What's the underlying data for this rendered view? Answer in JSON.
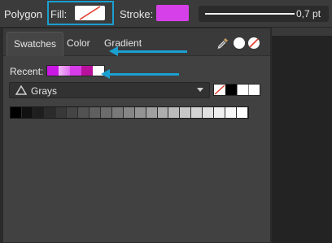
{
  "toolbar": {
    "tool_name": "Polygon",
    "fill_label": "Fill:",
    "fill_color": "none",
    "stroke_label": "Stroke:",
    "stroke_color": "#d640e8",
    "stroke_width_value": "0,7 pt",
    "accent_highlight": "#1a9fd1"
  },
  "panel": {
    "tabs": [
      {
        "label": "Swatches",
        "active": true
      },
      {
        "label": "Color",
        "active": false
      },
      {
        "label": "Gradient",
        "active": false
      }
    ],
    "tools": [
      {
        "icon": "eyedropper-icon"
      },
      {
        "icon": "white-circle-icon"
      },
      {
        "icon": "no-color-icon"
      }
    ],
    "recent_label": "Recent:",
    "recent_colors": [
      "#c918e3",
      "#f2b8f8",
      "#d63ce8",
      "#b8129c",
      "#ffffff"
    ],
    "palette_select": {
      "icon": "palette-icon",
      "value": "Grays"
    },
    "quick_colors": [
      "none",
      "#000000",
      "#ffffff",
      "#ffffff"
    ],
    "grays": [
      "#000000",
      "#111111",
      "#1e1e1e",
      "#2b2b2b",
      "#383838",
      "#454545",
      "#525252",
      "#5f5f5f",
      "#6c6c6c",
      "#797979",
      "#868686",
      "#939393",
      "#a0a0a0",
      "#adadad",
      "#bababa",
      "#c7c7c7",
      "#d4d4d4",
      "#e1e1e1",
      "#eeeeee",
      "#f6f6f6",
      "#ffffff"
    ]
  }
}
